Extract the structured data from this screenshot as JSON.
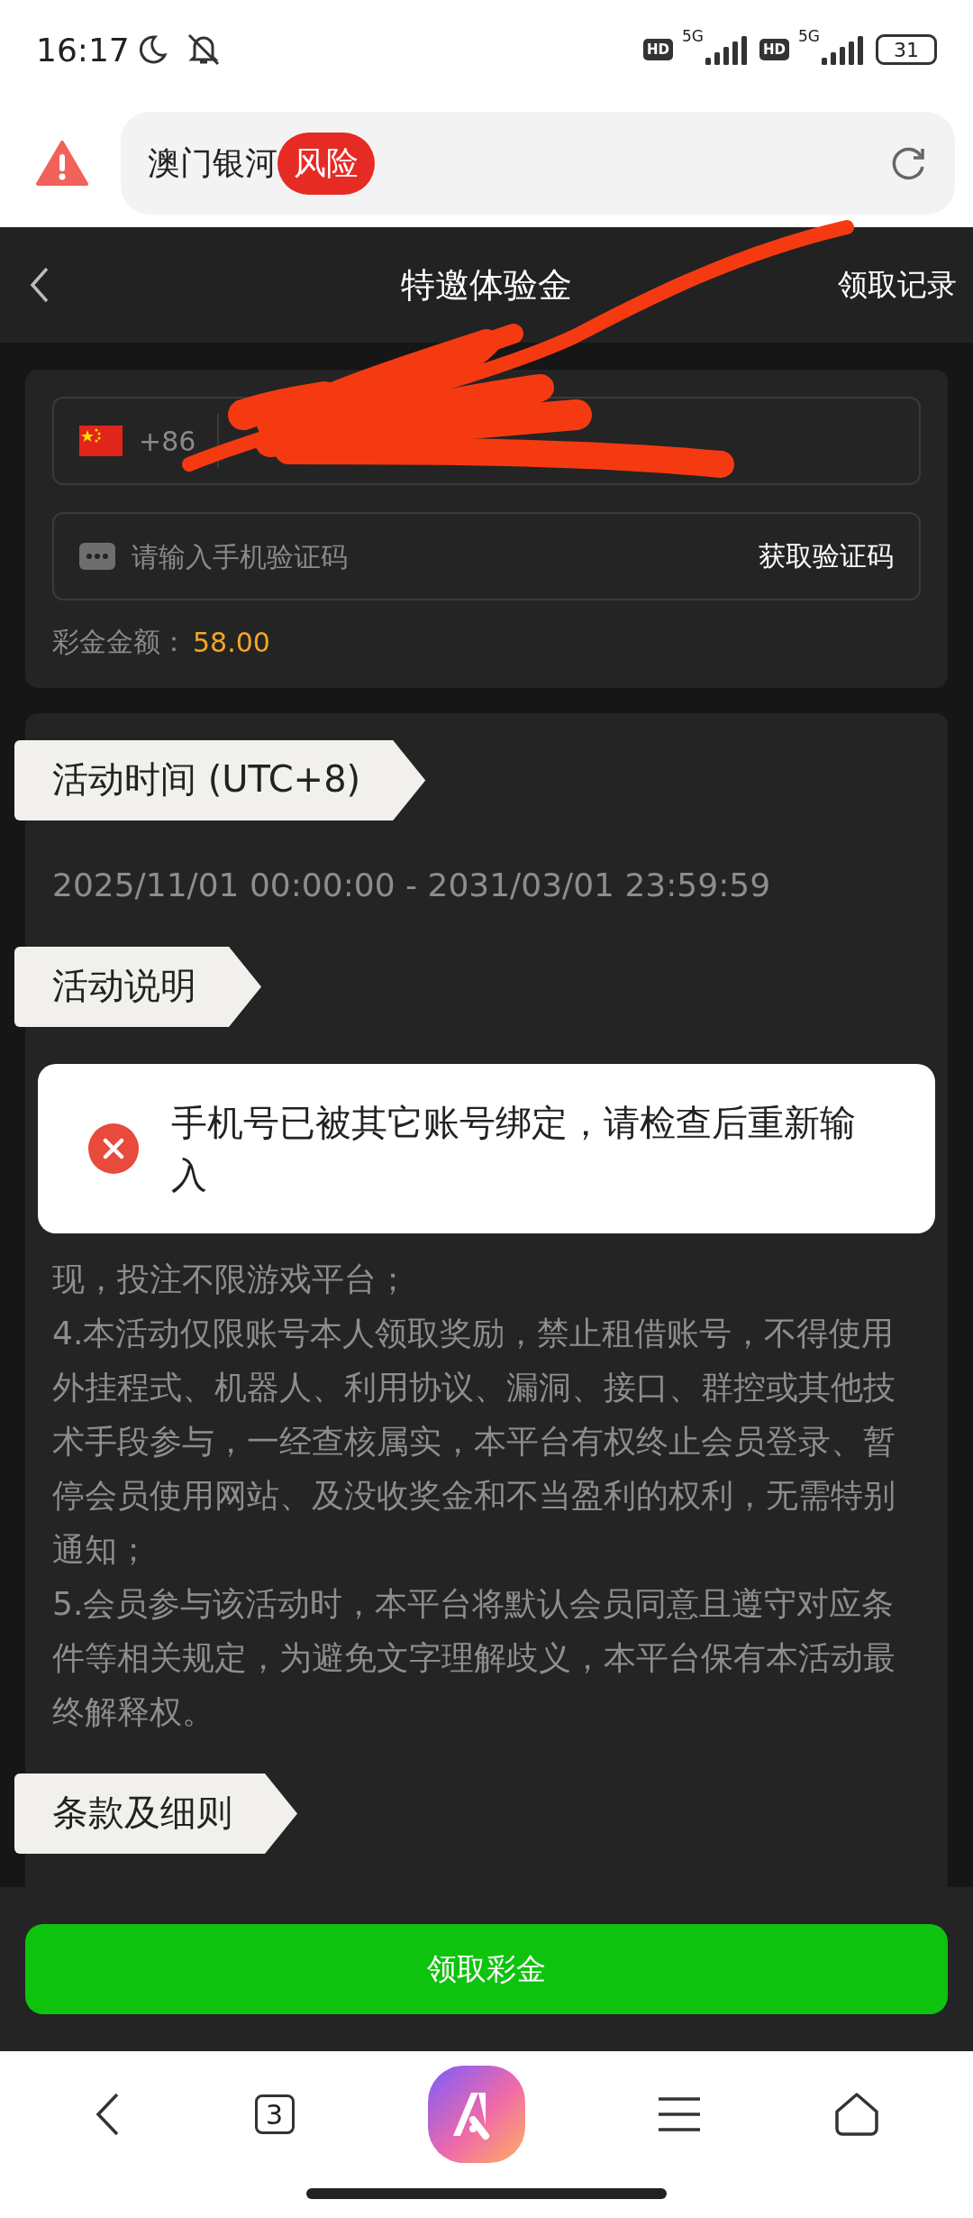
{
  "status_bar": {
    "time": "16:17",
    "hd_1": "HD",
    "network_1": "5G",
    "hd_2": "HD",
    "network_2": "5G",
    "battery": "31"
  },
  "address_bar": {
    "site": "澳门银河",
    "risk_badge": "风险"
  },
  "nav": {
    "title": "特邀体验金",
    "action": "领取记录"
  },
  "form": {
    "country_code": "+86",
    "code_field": {
      "placeholder": "请输入手机验证码"
    },
    "get_code_button": "获取验证码",
    "bonus_label": "彩金金额：",
    "bonus_amount": "58.00"
  },
  "sections": [
    {
      "heading": "活动时间 (UTC+8)",
      "paragraphs": [
        "2025/11/01 00:00:00 - 2031/03/01 23:59:59"
      ]
    },
    {
      "heading": "活动说明",
      "paragraphs": [
        "现，投注不限游戏平台；",
        "4.本活动仅限账号本人领取奖励，禁止租借账号，不得使用外挂程式、机器人、利用协议、漏洞、接口、群控或其他技术手段参与，一经查核属实，本平台有权终止会员登录、暂停会员使用网站、及没收奖金和不当盈利的权利，无需特别通知；",
        "5.会员参与该活动时，本平台将默认会员同意且遵守对应条件等相关规定，为避免文字理解歧义，本平台保有本活动最终解释权。"
      ]
    },
    {
      "heading": "条款及细则"
    }
  ],
  "toast": {
    "message": "手机号已被其它账号绑定，请检查后重新输入"
  },
  "claim_button": "领取彩金",
  "browser_bar": {
    "tab_count": "3"
  }
}
